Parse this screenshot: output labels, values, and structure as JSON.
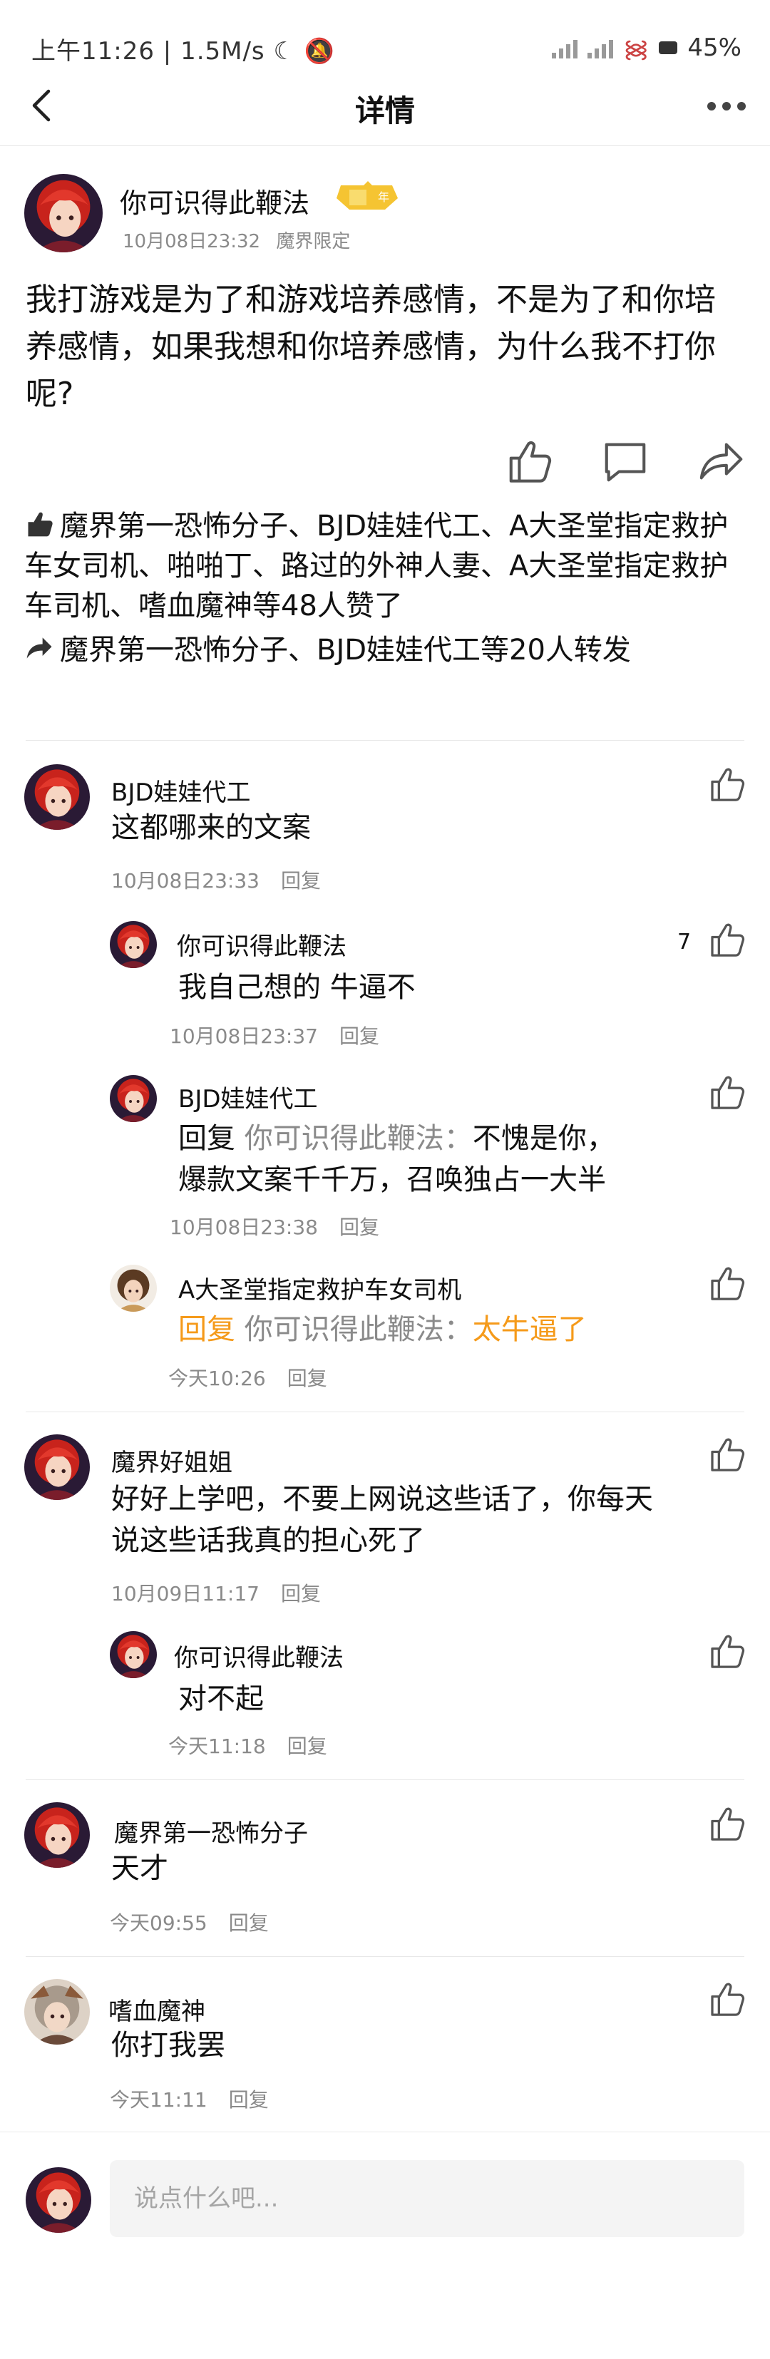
{
  "status": {
    "time": "上午11:26",
    "speed": "1.5M/s",
    "battery": "45%"
  },
  "header": {
    "title": "详情"
  },
  "post": {
    "author": "你可识得此鞭法",
    "badge": "年",
    "date": "10月08日23:32",
    "tag": "魔界限定",
    "content": "我打游戏是为了和游戏培养感情，不是为了和你培养感情，如果我想和你培养感情，为什么我不打你呢?",
    "likes_text": "魔界第一恐怖分子、BJD娃娃代工、A大圣堂指定救护车女司机、啪啪丁、路过的外神人妻、A大圣堂指定救护车司机、嗜血魔神等48人赞了",
    "shares_text": "魔界第一恐怖分子、BJD娃娃代工等20人转发"
  },
  "comments": [
    {
      "name": "BJD娃娃代工",
      "text": "这都哪来的文案",
      "date": "10月08日23:33",
      "reply_label": "回复",
      "replies": [
        {
          "name": "你可识得此鞭法",
          "text": "我自己想的 牛逼不",
          "date": "10月08日23:37",
          "reply_label": "回复",
          "like_count": "7"
        },
        {
          "name": "BJD娃娃代工",
          "prefix": "回复",
          "target": "你可识得此鞭法：",
          "text": "不愧是你，",
          "text2": "爆款文案千千万，召唤独占一大半",
          "date": "10月08日23:38",
          "reply_label": "回复"
        },
        {
          "name": "A大圣堂指定救护车女司机",
          "prefix": "回复",
          "target": "你可识得此鞭法：",
          "text": "太牛逼了",
          "date": "今天10:26",
          "reply_label": "回复"
        }
      ]
    },
    {
      "name": "魔界好姐姐",
      "text": "好好上学吧，不要上网说这些话了，你每天说这些话我真的担心死了",
      "date": "10月09日11:17",
      "reply_label": "回复",
      "replies": [
        {
          "name": "你可识得此鞭法",
          "text": "对不起",
          "date": "今天11:18",
          "reply_label": "回复"
        }
      ]
    },
    {
      "name": "魔界第一恐怖分子",
      "text": "天才",
      "date": "今天09:55",
      "reply_label": "回复"
    },
    {
      "name": "嗜血魔神",
      "text": "你打我罢",
      "date": "今天11:11",
      "reply_label": "回复"
    }
  ],
  "input": {
    "placeholder": "说点什么吧..."
  },
  "colors": {
    "accent_orange": "#f59a1a",
    "muted": "#8a8a8a",
    "avatar_red": "#d9342b"
  }
}
